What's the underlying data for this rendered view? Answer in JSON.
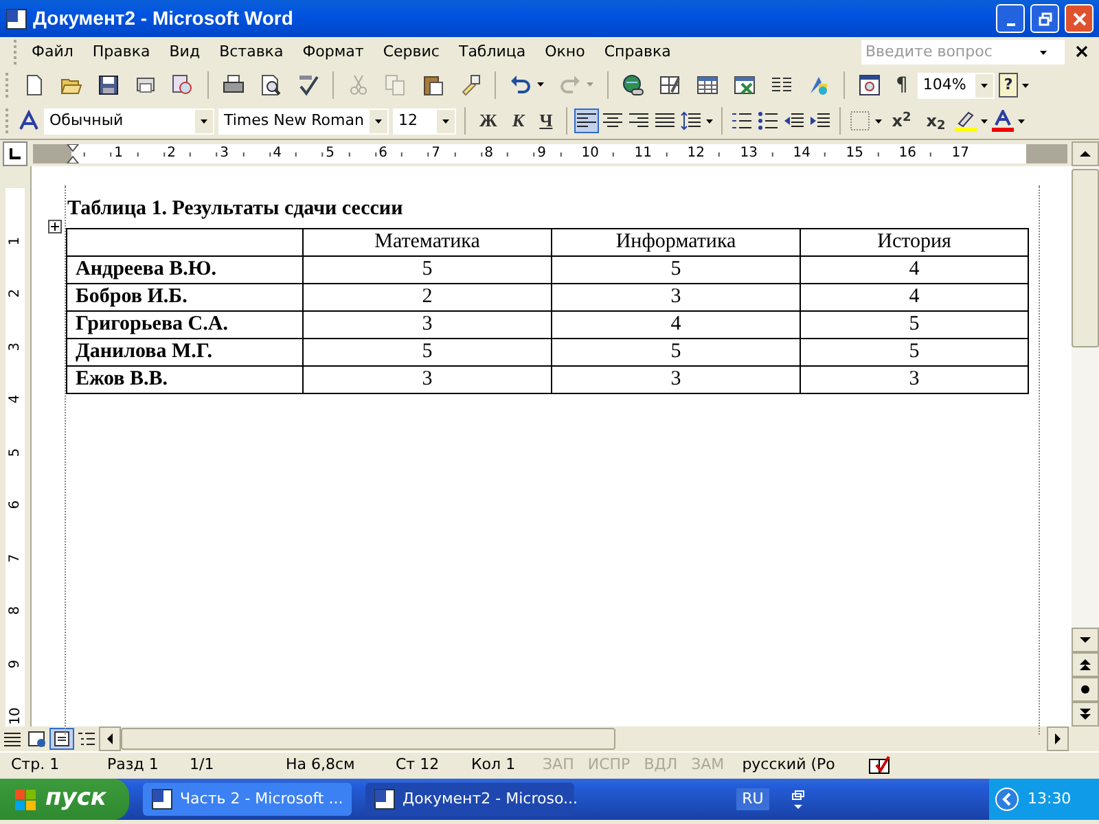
{
  "window": {
    "title": "Документ2 - Microsoft Word"
  },
  "menu": [
    "Файл",
    "Правка",
    "Вид",
    "Вставка",
    "Формат",
    "Сервис",
    "Таблица",
    "Окно",
    "Справка"
  ],
  "help_search": {
    "placeholder": "Введите вопрос"
  },
  "standard_toolbar": {
    "buttons": [
      {
        "kind": "new",
        "disabled": false
      },
      {
        "kind": "open",
        "disabled": false
      },
      {
        "kind": "save",
        "disabled": false
      },
      {
        "kind": "permission",
        "disabled": false
      },
      {
        "kind": "research",
        "disabled": false
      },
      {
        "kind": "sep"
      },
      {
        "kind": "print",
        "disabled": false
      },
      {
        "kind": "preview",
        "disabled": false
      },
      {
        "kind": "spelling",
        "disabled": false
      },
      {
        "kind": "sep"
      },
      {
        "kind": "cut",
        "disabled": true
      },
      {
        "kind": "copy",
        "disabled": true
      },
      {
        "kind": "paste",
        "disabled": false
      },
      {
        "kind": "painter",
        "disabled": false
      },
      {
        "kind": "sep"
      },
      {
        "kind": "undo",
        "disabled": false
      },
      {
        "kind": "redo",
        "disabled": true
      },
      {
        "kind": "sep"
      },
      {
        "kind": "hyperlink",
        "disabled": false
      },
      {
        "kind": "tables",
        "disabled": false
      },
      {
        "kind": "table",
        "disabled": false
      },
      {
        "kind": "sheet",
        "disabled": false
      },
      {
        "kind": "columns",
        "disabled": false
      },
      {
        "kind": "drawing",
        "disabled": false
      },
      {
        "kind": "sep"
      },
      {
        "kind": "docmap",
        "disabled": false
      }
    ],
    "show_marks": "¶",
    "zoom": "104%",
    "help_button": "?"
  },
  "format_toolbar": {
    "style": "Обычный",
    "font": "Times New Roman",
    "size": "12",
    "font_buttons": [
      "Ж",
      "К",
      "Ч"
    ],
    "alignment": [
      {
        "kind": "left",
        "selected": true
      },
      {
        "kind": "center",
        "selected": false
      },
      {
        "kind": "right",
        "selected": false
      },
      {
        "kind": "justify",
        "selected": false
      }
    ],
    "script_buttons": [
      "x$^{2}$",
      "x$_{2}$"
    ]
  },
  "ruler": {
    "marks": [
      "1",
      "2",
      "3",
      "4",
      "5",
      "6",
      "7",
      "8",
      "9",
      "10",
      "11",
      "12",
      "13",
      "14",
      "15",
      "16",
      "17"
    ]
  },
  "vertical_ruler": {
    "marks": [
      "1",
      "2",
      "3",
      "4",
      "5",
      "6",
      "7",
      "8",
      "9",
      "10"
    ]
  },
  "document": {
    "caption": "Таблица 1. Результаты сдачи сессии",
    "table": {
      "columns": [
        "",
        "Математика",
        "Информатика",
        "История"
      ],
      "rows": [
        [
          "Андреева В.Ю.",
          "5",
          "5",
          "4"
        ],
        [
          "Бобров И.Б.",
          "2",
          "3",
          "4"
        ],
        [
          "Григорьева С.А.",
          "3",
          "4",
          "5"
        ],
        [
          "Данилова М.Г.",
          "5",
          "5",
          "5"
        ],
        [
          "Ежов В.В.",
          "3",
          "3",
          "3"
        ]
      ]
    }
  },
  "views": [
    {
      "kind": "normal",
      "selected": false
    },
    {
      "kind": "web",
      "selected": false
    },
    {
      "kind": "print",
      "selected": true
    },
    {
      "kind": "outline",
      "selected": false
    }
  ],
  "status_bar": {
    "fields": [
      "Стр. 1",
      "Разд 1",
      "1/1",
      "На 6,8см",
      "Ст 12",
      "Кол 1"
    ],
    "modes": [
      {
        "label": "ЗАП",
        "disabled": true
      },
      {
        "label": "ИСПР",
        "disabled": true
      },
      {
        "label": "ВДЛ",
        "disabled": true
      },
      {
        "label": "ЗАМ",
        "disabled": true
      }
    ],
    "language": "русский (Ро"
  },
  "taskbar": {
    "start": "пуск",
    "tasks": [
      {
        "label": "Часть 2 - Microsoft ...",
        "selected": false
      },
      {
        "label": "Документ2 - Microso...",
        "selected": true
      }
    ],
    "language": "RU",
    "clock": "13:30"
  }
}
